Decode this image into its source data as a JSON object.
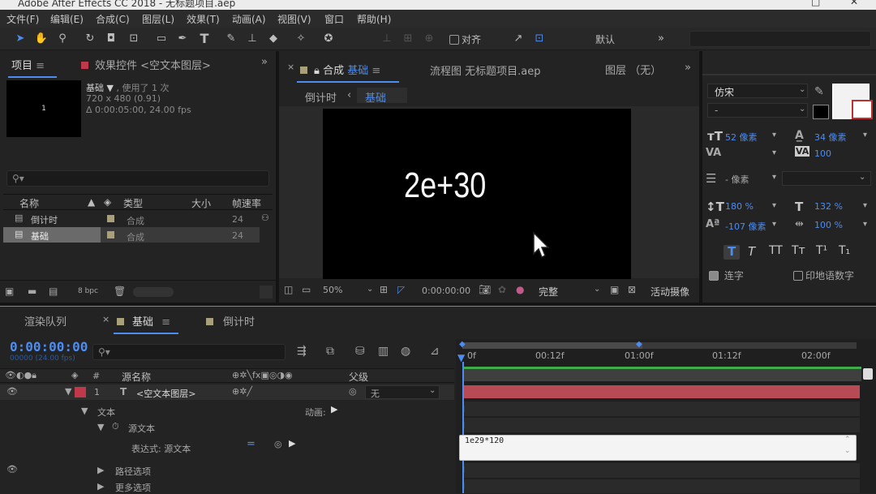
{
  "app": {
    "title": "Adobe After Effects CC 2018 - 无标题项目.aep"
  },
  "menu": [
    "文件(F)",
    "编辑(E)",
    "合成(C)",
    "图层(L)",
    "效果(T)",
    "动画(A)",
    "视图(V)",
    "窗口",
    "帮助(H)"
  ],
  "toolbar": {
    "snap_label": "对齐",
    "workspace": "默认"
  },
  "project_panel": {
    "tab_label": "项目",
    "effects_tab": "效果控件 <空文本图层>",
    "preview_char": "1",
    "comp_name": "基础",
    "comp_used": ", 使用了 1 次",
    "comp_size": "720 x 480 (0.91)",
    "comp_duration": "Δ 0:00:05:00, 24.00 fps",
    "columns": [
      "名称",
      "类型",
      "大小",
      "帧速率"
    ],
    "items": [
      {
        "name": "倒计时",
        "type": "合成",
        "fps": "24"
      },
      {
        "name": "基础",
        "type": "合成",
        "fps": "24"
      }
    ],
    "bpc": "8 bpc"
  },
  "composition_panel": {
    "tab_label": "合成",
    "tab_active": "基础",
    "flowchart_tab": "流程图 无标题项目.aep",
    "layer_tab": "图层 （无）",
    "breadcrumb": [
      "倒计时",
      "基础"
    ],
    "viewer_text": "2e+30",
    "zoom": "50%",
    "timecode": "0:00:00:00",
    "resolution": "完整",
    "camera": "活动摄像"
  },
  "character_panel": {
    "font_family": "仿宋",
    "font_style": "-",
    "font_size": "52 像素",
    "leading": "34 像素",
    "tracking": "100",
    "stroke_width": "- 像素",
    "vertical_scale": "180 %",
    "horizontal_scale": "132 %",
    "baseline_shift": "-107 像素",
    "tsume": "100 %",
    "ligatures_label": "连字",
    "hindi_digits_label": "印地语数字"
  },
  "timeline_panel": {
    "render_queue_tab": "渲染队列",
    "active_tab": "基础",
    "countdown_tab": "倒计时",
    "current_time": "0:00:00:00",
    "time_sub": "00000 (24.00 fps)",
    "columns": {
      "num": "#",
      "source_name": "源名称",
      "parent": "父级"
    },
    "layer": {
      "index": "1",
      "name": "<空文本图层>",
      "parent": "无"
    },
    "props": {
      "text": "文本",
      "animate": "动画:",
      "source_text": "源文本",
      "expression_label": "表达式: 源文本",
      "path_options": "路径选项",
      "more_options": "更多选项"
    },
    "ruler": [
      "0f",
      "00:12f",
      "01:00f",
      "01:12f",
      "02:00f"
    ],
    "expression": "1e29*120"
  },
  "colors": {
    "accent_blue": "#4d8cf0",
    "layer_red": "#b84a56",
    "layer_label": "#c0394a"
  }
}
